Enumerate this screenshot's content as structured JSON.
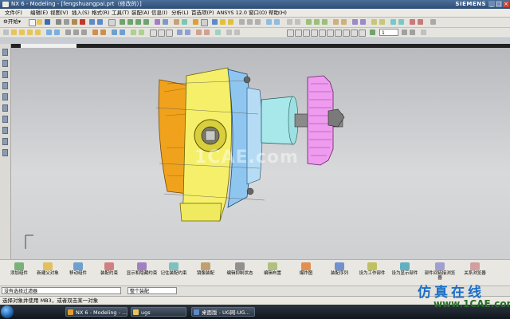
{
  "titlebar": {
    "title": "NX 6 - Modeling - [fengshuangpai.prt（修改的）]",
    "brand": "SIEMENS",
    "min": "_",
    "max": "□",
    "close": "×"
  },
  "menu": [
    "文件(F)",
    "编辑(E)",
    "视图(V)",
    "插入(S)",
    "格式(R)",
    "工具(T)",
    "装配(A)",
    "信息(I)",
    "分析(L)",
    "首选项(P)",
    "ANSYS 12.0",
    "窗口(O)",
    "帮助(H)"
  ],
  "toolbar": {
    "start_label": "开始",
    "layer_value": "1"
  },
  "viewport": {
    "watermark": "1CAE.com"
  },
  "assembly_toolbar": [
    "添加组件",
    "新建父对象",
    "移动组件",
    "装配约束",
    "显示和隐藏约束",
    "记住装配约束",
    "镜像装配",
    "编辑抑制状态",
    "编辑布置",
    "爆炸图",
    "装配序列",
    "设为工作部件",
    "设为显示部件",
    "部件间链接浏览器",
    "关系浏览器"
  ],
  "selection": {
    "filter": "没有选择过滤器",
    "scope": "整个装配"
  },
  "status": {
    "prompt": "选择对象并使用 MB3，或者双击某一对象"
  },
  "taskbar": {
    "items": [
      "NX 6 - Modeling - ...",
      "ugs",
      "桌面版 - UG网-UG..."
    ]
  },
  "brand_logo": {
    "cn": "仿真在线",
    "en": "www.1CAE.com"
  },
  "colors": {
    "orange_part": "#f0a21c",
    "yellow_part": "#f5ef6a",
    "blue_part": "#8fc6f0",
    "cyan_part": "#a9e8ea",
    "gear": "#ef9cf0"
  }
}
